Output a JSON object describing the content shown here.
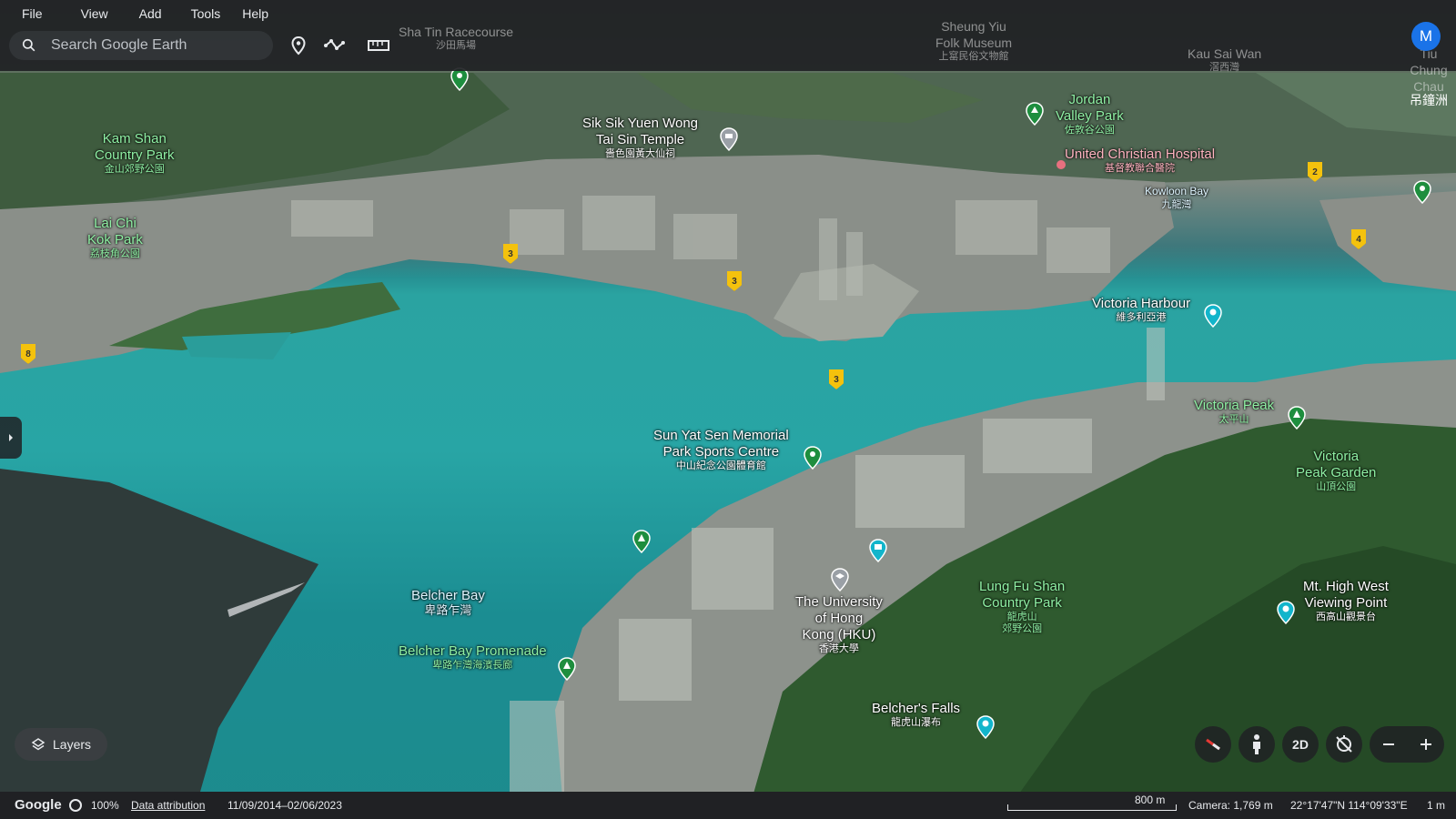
{
  "menu": [
    "File",
    "View",
    "Add",
    "Tools",
    "Help"
  ],
  "search": {
    "placeholder": "Search Google Earth"
  },
  "toolbar": {
    "icons": [
      "place-pin-icon",
      "path-icon",
      "ruler-icon"
    ]
  },
  "user": {
    "avatar_initial": "M"
  },
  "places": [
    {
      "en": "Kam Shan\nCountry Park",
      "zh": "金山郊野公園",
      "style": "green"
    },
    {
      "en": "Lai Chi\nKok Park",
      "zh": "荔枝角公園",
      "style": "green"
    },
    {
      "en": "Sik Sik Yuen Wong\nTai Sin Temple",
      "zh": "嗇色園黃大仙祠",
      "style": "white"
    },
    {
      "en": "Jordan\nValley Park",
      "zh": "佐敦谷公園",
      "style": "green"
    },
    {
      "en": "United Christian Hospital",
      "zh": "基督教聯合醫院",
      "style": "pink"
    },
    {
      "en": "Kowloon Bay",
      "zh": "九龍灣",
      "style": "bluewater"
    },
    {
      "en": "Victoria Harbour",
      "zh": "維多利亞港",
      "style": "white"
    },
    {
      "en": "Victoria Peak",
      "zh": "太平山",
      "style": "green"
    },
    {
      "en": "Victoria\nPeak Garden",
      "zh": "山頂公園",
      "style": "green"
    },
    {
      "en": "Sun Yat Sen Memorial\nPark Sports Centre",
      "zh": "中山紀念公園體育館",
      "style": "white"
    },
    {
      "en": "Belcher Bay",
      "zh": "卑路乍灣",
      "style": "bluewater"
    },
    {
      "en": "Belcher Bay Promenade",
      "zh": "卑路乍灣海濱長廊",
      "style": "green"
    },
    {
      "en": "The University\nof Hong\nKong (HKU)",
      "zh": "香港大學",
      "style": "white"
    },
    {
      "en": "Lung Fu Shan\nCountry Park",
      "zh": "龍虎山\n郊野公園",
      "style": "green"
    },
    {
      "en": "Mt. High West\nViewing Point",
      "zh": "西高山觀景台",
      "style": "white"
    },
    {
      "en": "Belcher's Falls",
      "zh": "龍虎山瀑布",
      "style": "white"
    },
    {
      "en": "Sha Tin Racecourse",
      "zh": "沙田馬場",
      "style": "faint"
    },
    {
      "en": "Sheung Yiu\nFolk Museum",
      "zh": "上窰民俗文物館",
      "style": "faint"
    },
    {
      "en": "Kau Sai Wan",
      "zh": "滘西灣",
      "style": "faint"
    },
    {
      "en": "Tiu Chung\nChau",
      "zh": "吊鐘洲",
      "style": "faint"
    }
  ],
  "road_shields": [
    "3",
    "3",
    "3",
    "2",
    "4",
    "8"
  ],
  "side_panel": {
    "toggle_icon": "chevron-right-icon"
  },
  "layers": {
    "label": "Layers"
  },
  "controls": {
    "compass_icon": "compass-icon",
    "pegman_icon": "pegman-icon",
    "view_toggle": "2D",
    "reset_icon": "reset-tilt-icon",
    "zoom_out_icon": "minus-icon",
    "zoom_in_icon": "plus-icon"
  },
  "status": {
    "brand": "Google",
    "loading_percent": "100%",
    "attribution": "Data attribution",
    "imagery_dates": "11/09/2014–02/06/2023",
    "scale_label": "800 m",
    "camera": "Camera: 1,769 m",
    "coordinates": "22°17'47\"N 114°09'33\"E",
    "elevation": "1 m"
  }
}
